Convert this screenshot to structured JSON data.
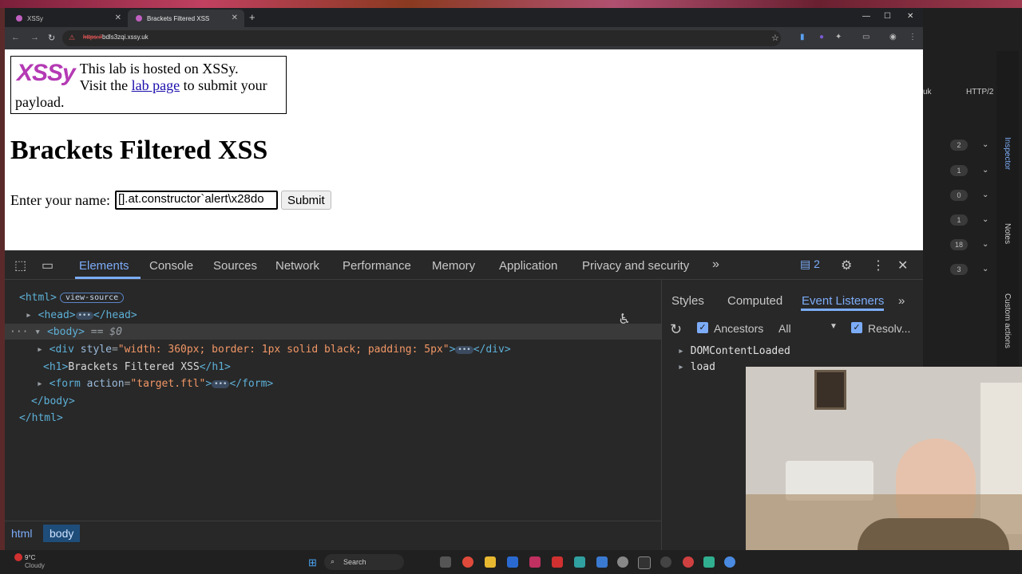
{
  "browser": {
    "tabs": [
      {
        "label": "XSSy",
        "active": false
      },
      {
        "label": "Brackets Filtered XSS",
        "active": true
      }
    ],
    "url_scheme": "https://",
    "url_rest": "bdls3zqi.xssy.uk"
  },
  "page": {
    "lab_logo": "XSSy",
    "lab_line1": "This lab is hosted on XSSy.",
    "lab_visit_prefix": "Visit the",
    "lab_link": "lab page",
    "lab_visit_suffix": "to submit your payload.",
    "heading": "Brackets Filtered XSS",
    "form_label": "Enter your name:",
    "input_value": "[].at.constructor`alert\\x28do",
    "submit_label": "Submit"
  },
  "devtools": {
    "tabs": [
      "Elements",
      "Console",
      "Sources",
      "Network",
      "Performance",
      "Memory",
      "Application",
      "Privacy and security"
    ],
    "active_tab": "Elements",
    "issues_count": "2",
    "dom": {
      "html_open": "<html>",
      "view_source": "view-source",
      "head": "<head>",
      "head_close": "</head>",
      "body_open": "<body>",
      "body_eq": "== $0",
      "div_open": "<div",
      "div_attr": "style",
      "div_val": "\"width: 360px; border: 1px solid black; padding: 5px\"",
      "div_close": "</div>",
      "h1_open": "<h1>",
      "h1_text": "Brackets Filtered XSS",
      "h1_close": "</h1>",
      "form_open": "<form",
      "form_attr": "action",
      "form_val": "\"target.ftl\"",
      "form_close": "</form>",
      "body_close": "</body>",
      "html_close": "</html>"
    },
    "breadcrumbs": [
      "html",
      "body"
    ],
    "sidepane": {
      "tabs": [
        "Styles",
        "Computed",
        "Event Listeners"
      ],
      "active_tab": "Event Listeners",
      "ancestors_label": "Ancestors",
      "filter_value": "All",
      "resolve_label": "Resolv...",
      "events": [
        "DOMContentLoaded",
        "load"
      ]
    }
  },
  "right_panel": {
    "labels": [
      "uk",
      "HTTP/2"
    ],
    "counts": [
      "2",
      "1",
      "0",
      "1",
      "18",
      "3"
    ],
    "vertical_tabs": [
      "Inspector",
      "Notes",
      "Custom actions"
    ]
  },
  "taskbar": {
    "weather_temp": "9°C",
    "weather_desc": "Cloudy",
    "search_placeholder": "Search"
  },
  "colors": {
    "accent": "#7cacf8",
    "logo": "#b43ab4",
    "link": "#1a0dab"
  }
}
